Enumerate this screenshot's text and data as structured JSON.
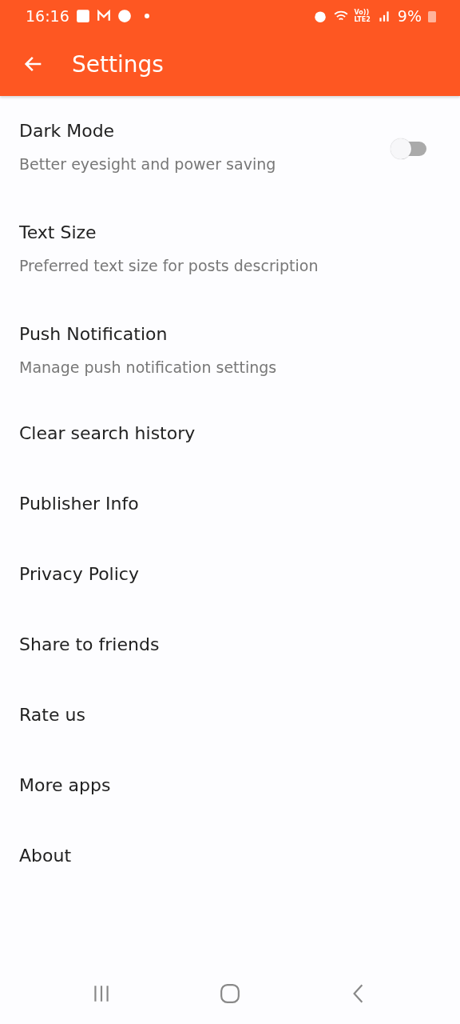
{
  "status_bar": {
    "time": "16:16",
    "network": "Vo))",
    "network_type": "LTE2",
    "battery": "9%"
  },
  "app_bar": {
    "title": "Settings"
  },
  "settings": [
    {
      "kind": "toggle",
      "title": "Dark Mode",
      "subtitle": "Better eyesight and power saving",
      "on": false
    },
    {
      "kind": "detail",
      "title": "Text Size",
      "subtitle": "Preferred text size for posts description"
    },
    {
      "kind": "detail",
      "title": "Push Notification",
      "subtitle": "Manage push notification settings"
    },
    {
      "kind": "plain",
      "title": "Clear search history"
    },
    {
      "kind": "plain",
      "title": "Publisher Info"
    },
    {
      "kind": "plain",
      "title": "Privacy Policy"
    },
    {
      "kind": "plain",
      "title": "Share to friends"
    },
    {
      "kind": "plain",
      "title": "Rate us"
    },
    {
      "kind": "plain",
      "title": "More apps"
    },
    {
      "kind": "plain",
      "title": "About"
    }
  ]
}
